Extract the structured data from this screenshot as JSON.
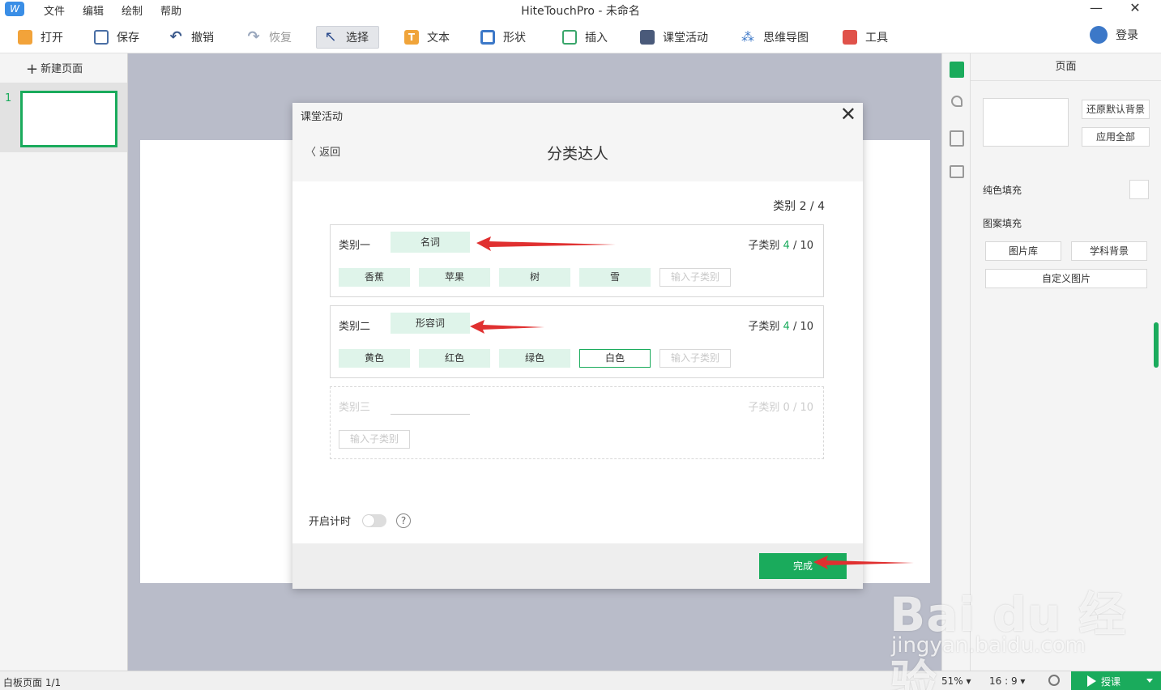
{
  "app": {
    "logo": "W",
    "title": "HiteTouchPro - 未命名",
    "menu": [
      "文件",
      "编辑",
      "绘制",
      "帮助"
    ],
    "window_controls": [
      "—",
      "✕"
    ]
  },
  "toolbar": {
    "open": "打开",
    "save": "保存",
    "undo": "撤销",
    "redo": "恢复",
    "select": "选择",
    "text": "文本",
    "shape": "形状",
    "insert": "插入",
    "activity": "课堂活动",
    "mindmap": "思维导图",
    "tools": "工具",
    "login": "登录",
    "icons": {
      "text": "T",
      "undo": "↶",
      "redo": "↷",
      "select": "↖",
      "mindmap": "⁂"
    }
  },
  "left_panel": {
    "new_page_icon": "+",
    "new_page": "新建页面",
    "pages": [
      {
        "number": "1"
      }
    ]
  },
  "properties": {
    "title": "页面",
    "restore_bg": "还原默认背景",
    "apply_all": "应用全部",
    "solid_fill": "纯色填充",
    "pattern_fill": "图案填充",
    "image_lib": "图片库",
    "subject_bg": "学科背景",
    "custom_image": "自定义图片"
  },
  "status": {
    "page_info": "白板页面 1/1",
    "zoom": "51% ▾",
    "ratio": "16 : 9 ▾",
    "teach": "授课"
  },
  "dialog": {
    "title": "课堂活动",
    "close": "✕",
    "back": "〈 返回",
    "heading": "分类达人",
    "category_count_label": "类别",
    "category_count": "2 / 4",
    "categories": [
      {
        "label": "类别一",
        "name": "名词",
        "sub_label": "子类别",
        "sub_current": "4",
        "sub_total": " / 10",
        "items": [
          "香蕉",
          "苹果",
          "树",
          "雪"
        ],
        "input_placeholder": "输入子类别"
      },
      {
        "label": "类别二",
        "name": "形容词",
        "sub_label": "子类别",
        "sub_current": "4",
        "sub_total": " / 10",
        "items": [
          "黄色",
          "红色",
          "绿色",
          "白色"
        ],
        "input_placeholder": "输入子类别"
      },
      {
        "label": "类别三",
        "name": "",
        "sub_label": "子类别",
        "sub_current": "0",
        "sub_total": " / 10",
        "input_placeholder": "输入子类别"
      }
    ],
    "timer_label": "开启计时",
    "timer_on": false,
    "help": "?",
    "done": "完成"
  },
  "watermark": {
    "line1": "Bai du 经验",
    "line2": "jingyan.baidu.com"
  },
  "colors": {
    "accent": "#1aab5c",
    "chip_bg": "#dff4ea",
    "canvas_bg": "#b9bcc9",
    "arrow": "#e03030"
  }
}
